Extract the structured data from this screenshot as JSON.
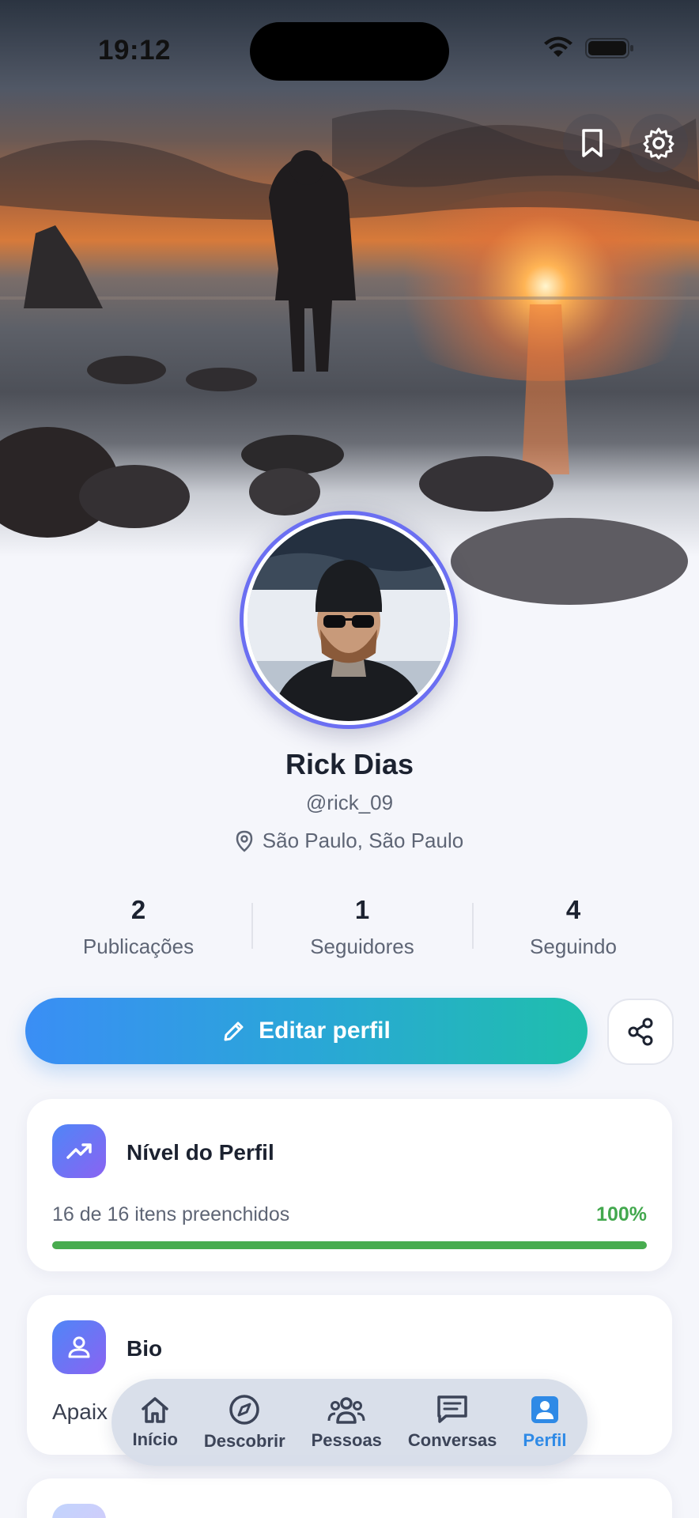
{
  "status_bar": {
    "time": "19:12"
  },
  "top_actions": {
    "bookmark_icon": "bookmark-icon",
    "settings_icon": "gear-icon"
  },
  "profile": {
    "name": "Rick Dias",
    "handle": "@rick_09",
    "location": "São Paulo, São Paulo"
  },
  "stats": [
    {
      "value": "2",
      "label": "Publicações"
    },
    {
      "value": "1",
      "label": "Seguidores"
    },
    {
      "value": "4",
      "label": "Seguindo"
    }
  ],
  "actions": {
    "edit_label": "Editar perfil"
  },
  "level_card": {
    "title": "Nível do Perfil",
    "progress_text": "16 de 16 itens preenchidos",
    "percent_label": "100%",
    "progress_fraction": 1.0
  },
  "bio_card": {
    "title": "Bio",
    "text": "Apaix"
  },
  "tabbar": {
    "items": [
      {
        "label": "Início",
        "icon": "home-icon"
      },
      {
        "label": "Descobrir",
        "icon": "compass-icon"
      },
      {
        "label": "Pessoas",
        "icon": "people-icon"
      },
      {
        "label": "Conversas",
        "icon": "chat-icon"
      },
      {
        "label": "Perfil",
        "icon": "profile-icon",
        "active": true
      }
    ]
  },
  "colors": {
    "accent": "#2f8ae6",
    "progress": "#48ac4f",
    "avatar_ring": "#6b6ff2"
  }
}
